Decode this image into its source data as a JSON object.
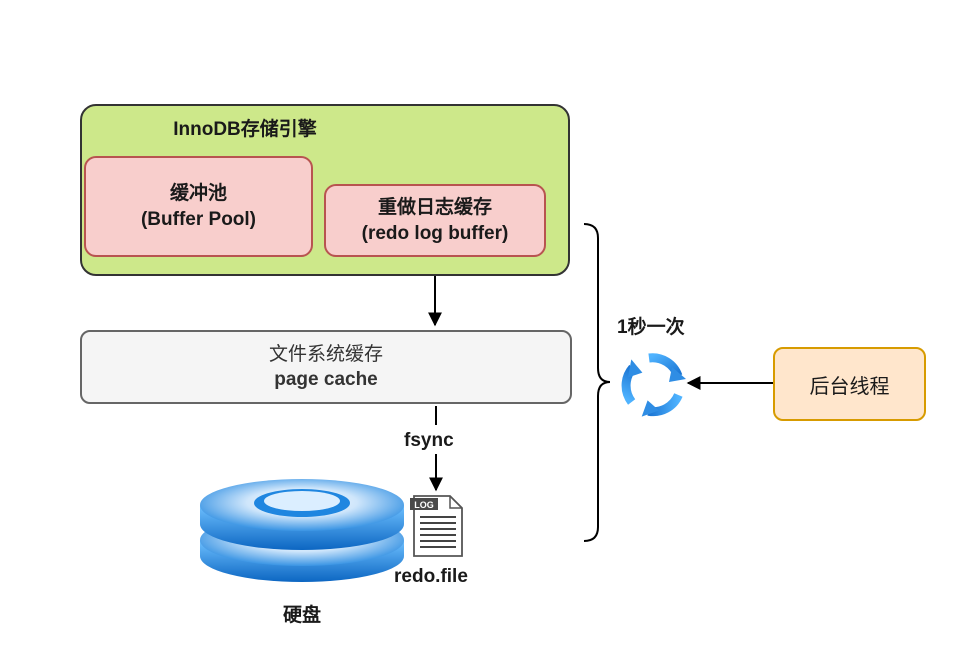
{
  "innodb": {
    "title": "InnoDB存储引擎"
  },
  "buffer_pool": {
    "line1": "缓冲池",
    "line2": "(Buffer Pool)"
  },
  "redo_log_buffer": {
    "line1": "重做日志缓存",
    "line2": "(redo log buffer)"
  },
  "page_cache": {
    "line1": "文件系统缓存",
    "line2": "page cache"
  },
  "fsync_label": "fsync",
  "redo_file": {
    "icon_text": "LOG",
    "label": "redo.file"
  },
  "disk_label": "硬盘",
  "interval_label": "1秒一次",
  "background_thread": "后台线程",
  "colors": {
    "innodb_fill": "#cde88a",
    "pink_fill": "#f8cecc",
    "pink_border": "#b85450",
    "cache_fill": "#f5f5f5",
    "thread_fill": "#ffe6cc",
    "thread_border": "#d79b00",
    "disk_blue": "#2f8fe0",
    "cycle_blue": "#2f8de4"
  }
}
